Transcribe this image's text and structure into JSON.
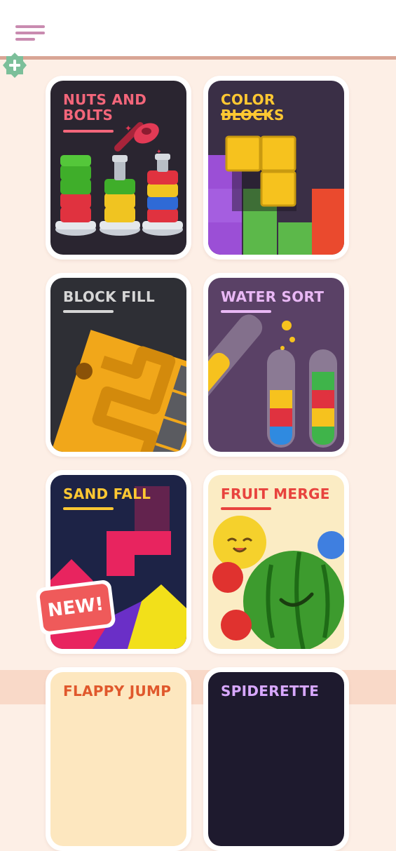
{
  "header": {
    "menu_icon": "hamburger-menu-icon",
    "add_icon": "plus-badge-icon"
  },
  "colors": {
    "accent": "#d9a595",
    "menu": "#c98bb0",
    "background": "#fdefe6"
  },
  "games": [
    {
      "title": "NUTS AND\nBOLTS",
      "title_color": "#f3667a",
      "bg": "#2a2530"
    },
    {
      "title": "COLOR BLOCKS",
      "title_color": "#ffc832",
      "bg": "#3a2f46"
    },
    {
      "title": "BLOCK FILL",
      "title_color": "#d6d6d6",
      "bg": "#2e2f35"
    },
    {
      "title": "WATER SORT",
      "title_color": "#e9b8f5",
      "bg": "#5a4166"
    },
    {
      "title": "SAND FALL",
      "title_color": "#ffc832",
      "bg": "#1d2346",
      "badge": "NEW!"
    },
    {
      "title": "FRUIT MERGE",
      "title_color": "#e8433e",
      "bg": "#fbecc4"
    },
    {
      "title": "FLAPPY JUMP",
      "title_color": "#e0582c",
      "bg": "#fde7bf"
    },
    {
      "title": "SPIDERETTE",
      "title_color": "#d8a8ff",
      "bg": "#1e1a2e"
    }
  ]
}
